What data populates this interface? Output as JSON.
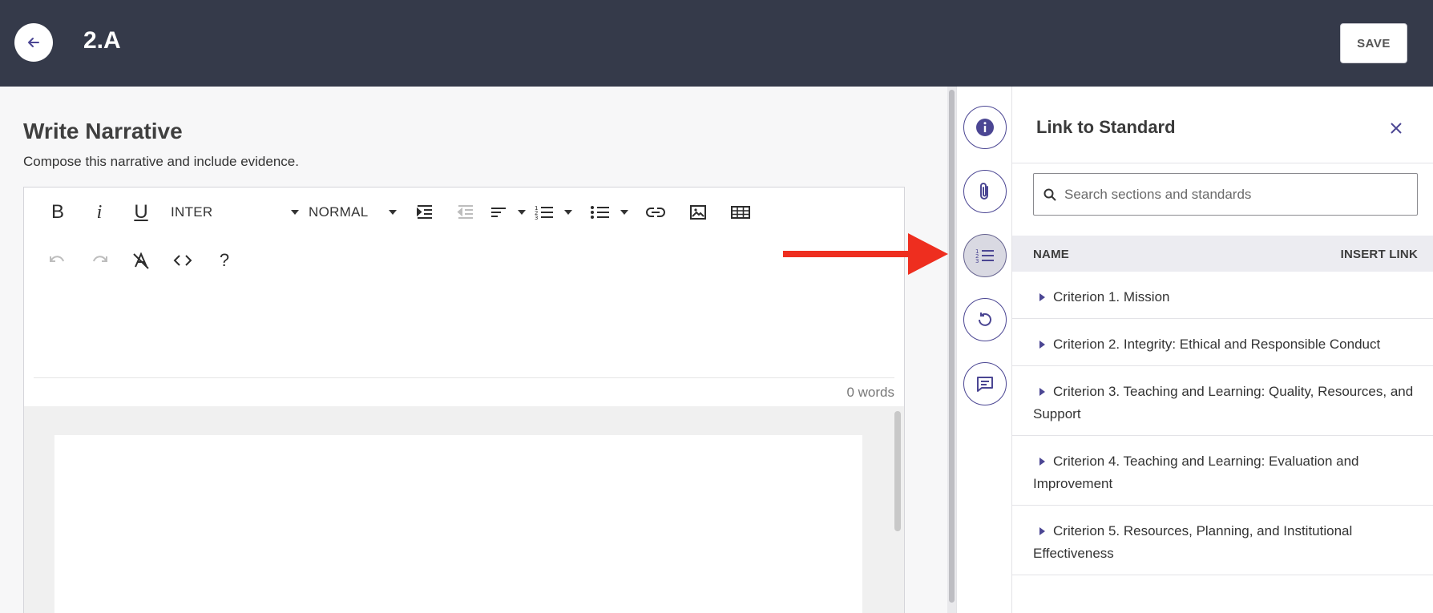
{
  "header": {
    "title": "2.A",
    "save_label": "SAVE"
  },
  "editor_section": {
    "title": "Write Narrative",
    "description": "Compose this narrative and include evidence.",
    "toolbar": {
      "bold_label": "B",
      "italic_label": "i",
      "underline_label": "U",
      "font_family": "INTER",
      "font_size": "NORMAL",
      "help_label": "?"
    },
    "word_count": "0 words"
  },
  "panel": {
    "title": "Link to Standard",
    "search_placeholder": "Search sections and standards",
    "col_name": "NAME",
    "col_insert": "INSERT LINK",
    "criteria": [
      "Criterion 1. Mission",
      "Criterion 2. Integrity: Ethical and Responsible Conduct",
      "Criterion 3. Teaching and Learning: Quality, Resources, and Support",
      "Criterion 4. Teaching and Learning: Evaluation and Improvement",
      "Criterion 5. Resources, Planning, and Institutional Effectiveness"
    ]
  },
  "rail_icons": [
    "info-icon",
    "paperclip-icon",
    "numbered-list-icon",
    "history-icon",
    "comment-icon"
  ],
  "colors": {
    "header_bg": "#353a4a",
    "accent": "#4b4693",
    "annotation_arrow": "#ee2e1f"
  }
}
